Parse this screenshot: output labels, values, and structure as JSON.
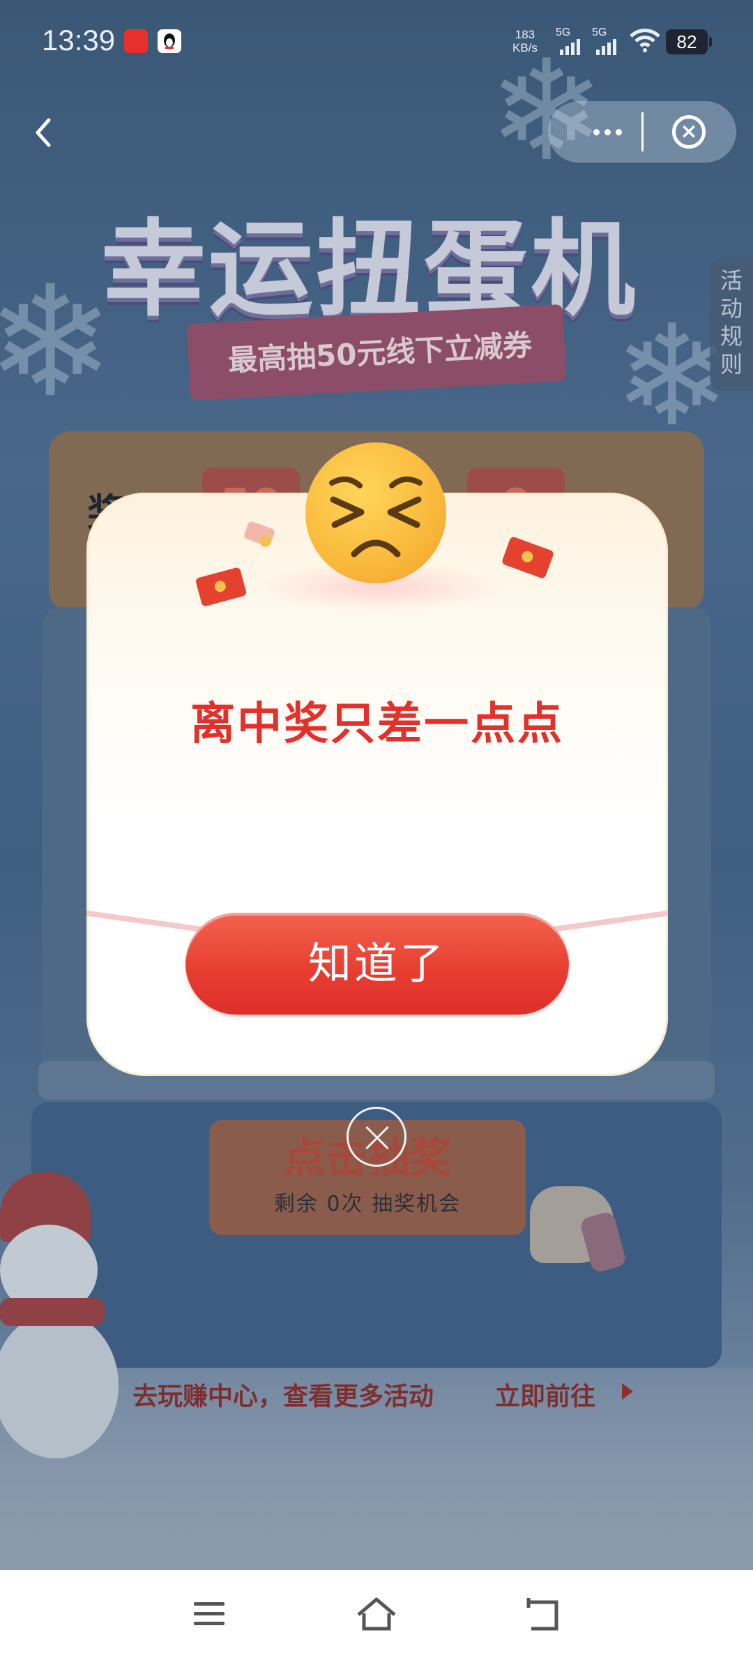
{
  "status_bar": {
    "time": "13:39",
    "net_speed_value": "183",
    "net_speed_unit": "KB/s",
    "signal1_label": "5G",
    "signal2_label": "5G",
    "battery": "82",
    "icons": [
      "app-notification-icon",
      "qq-icon",
      "signal-icon",
      "wifi-icon",
      "battery-icon"
    ]
  },
  "nav": {
    "back_icon": "chevron-left-icon",
    "more_icon": "more-dots-icon",
    "close_icon": "close-circle-icon"
  },
  "page": {
    "title": "幸运扭蛋机",
    "ribbon": "最高抽50元线下立减券",
    "rules": [
      "活",
      "动",
      "规",
      "则"
    ],
    "prize_label": "奖励",
    "slot_left": "50",
    "slot_right": "0",
    "draw_button": "点击抽奖",
    "draw_remaining": "剩余 0次 抽奖机会",
    "promo_text": "去玩赚中心，查看更多活动",
    "promo_link": "立即前往"
  },
  "modal": {
    "headline": "离中奖只差一点点",
    "confirm_button": "知道了",
    "emoji_icon": "sad-face-emoji-icon"
  },
  "navbar": {
    "icons": [
      "menu-icon",
      "home-icon",
      "back-icon"
    ]
  },
  "colors": {
    "accent_red": "#e2312a",
    "button_red": "#e63c30",
    "overlay_bg": "#3e5a7a"
  }
}
